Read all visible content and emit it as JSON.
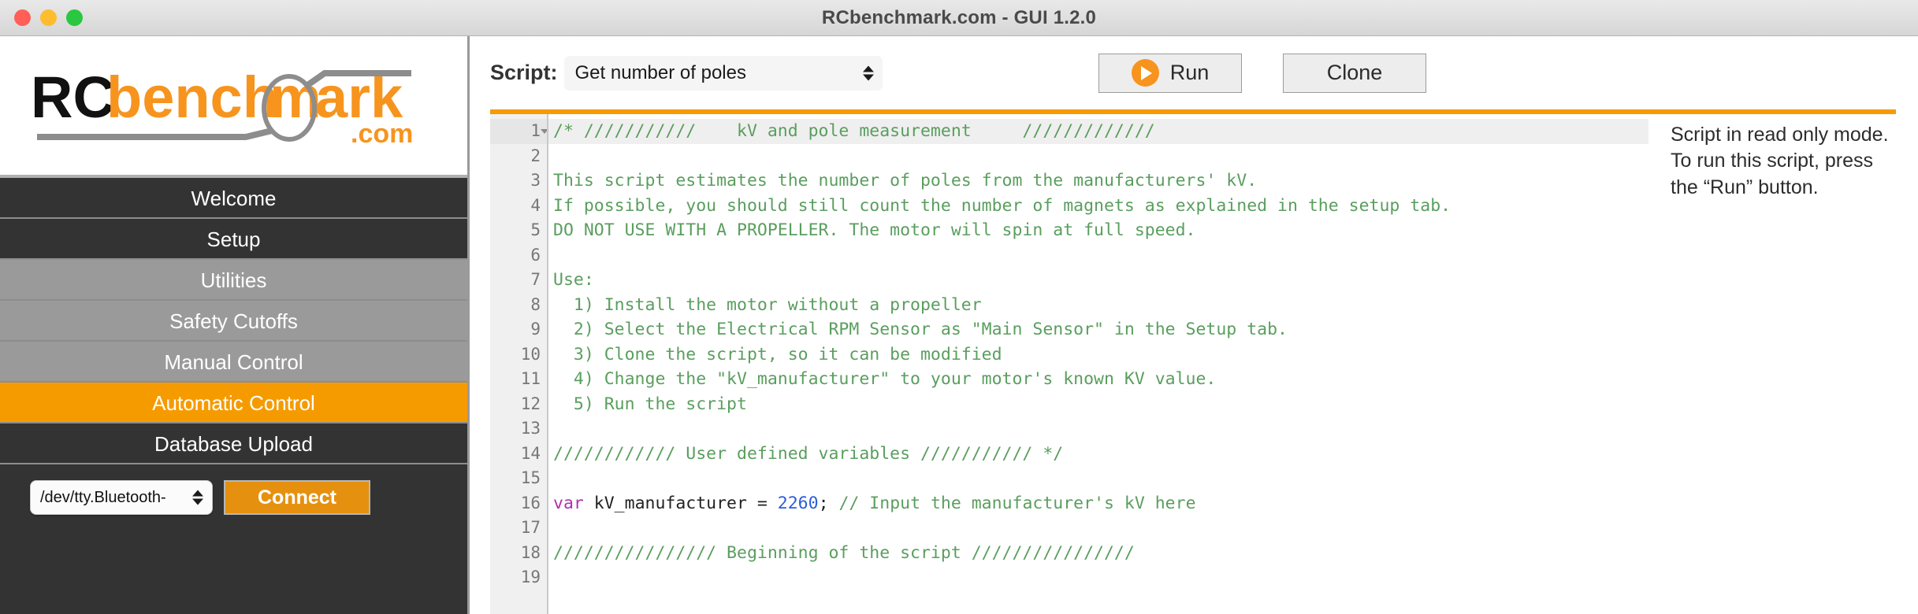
{
  "window": {
    "title": "RCbenchmark.com - GUI 1.2.0",
    "controls": {
      "close": "close-button",
      "minimize": "minimize-button",
      "zoom": "zoom-button"
    }
  },
  "sidebar": {
    "logo": {
      "text_black": "RC",
      "text_orange": "benchmark",
      "text_domain": ".com"
    },
    "items": [
      {
        "label": "Welcome",
        "state": "dark"
      },
      {
        "label": "Setup",
        "state": "dark"
      },
      {
        "label": "Utilities",
        "state": "gray"
      },
      {
        "label": "Safety Cutoffs",
        "state": "gray"
      },
      {
        "label": "Manual Control",
        "state": "gray"
      },
      {
        "label": "Automatic Control",
        "state": "active"
      },
      {
        "label": "Database Upload",
        "state": "dark"
      }
    ],
    "connection": {
      "port_value": "/dev/tty.Bluetooth-",
      "connect_label": "Connect"
    }
  },
  "toolbar": {
    "script_label": "Script:",
    "script_value": "Get number of poles",
    "run_label": "Run",
    "clone_label": "Clone"
  },
  "editor": {
    "lines": [
      {
        "n": "1",
        "text": "/* ///////////    kV and pole measurement     /////////////"
      },
      {
        "n": "2",
        "text": ""
      },
      {
        "n": "3",
        "text": "This script estimates the number of poles from the manufacturers' kV."
      },
      {
        "n": "4",
        "text": "If possible, you should still count the number of magnets as explained in the setup tab."
      },
      {
        "n": "5",
        "text": "DO NOT USE WITH A PROPELLER. The motor will spin at full speed."
      },
      {
        "n": "6",
        "text": ""
      },
      {
        "n": "7",
        "text": "Use:"
      },
      {
        "n": "8",
        "text": "  1) Install the motor without a propeller"
      },
      {
        "n": "9",
        "text": "  2) Select the Electrical RPM Sensor as \"Main Sensor\" in the Setup tab."
      },
      {
        "n": "10",
        "text": "  3) Clone the script, so it can be modified"
      },
      {
        "n": "11",
        "text": "  4) Change the \"kV_manufacturer\" to your motor's known KV value."
      },
      {
        "n": "12",
        "text": "  5) Run the script"
      },
      {
        "n": "13",
        "text": ""
      },
      {
        "n": "14",
        "text": "//////////// User defined variables /////////// */"
      },
      {
        "n": "15",
        "text": ""
      },
      {
        "n": "16",
        "text": "var kV_manufacturer = 2260; // Input the manufacturer's kV here",
        "tokens": [
          {
            "t": "var",
            "c": "tok-kw"
          },
          {
            "t": " kV_manufacturer ",
            "c": "tok-txt"
          },
          {
            "t": "= ",
            "c": "tok-txt"
          },
          {
            "t": "2260",
            "c": "tok-num"
          },
          {
            "t": "; ",
            "c": "tok-txt"
          },
          {
            "t": "// Input the manufacturer's kV here",
            "c": "tok-com"
          }
        ]
      },
      {
        "n": "17",
        "text": ""
      },
      {
        "n": "18",
        "text": "//////////////// Beginning of the script ////////////////"
      },
      {
        "n": "19",
        "text": ""
      }
    ]
  },
  "side_note": {
    "message": "Script in read only mode. To run this script, press the “Run” button."
  },
  "colors": {
    "accent_orange": "#f59b00",
    "sidebar_dark": "#333333",
    "sidebar_gray": "#9a9a9a",
    "comment_green": "#5a9e5e",
    "keyword_purple": "#b030b0",
    "number_blue": "#2a5fd6"
  }
}
